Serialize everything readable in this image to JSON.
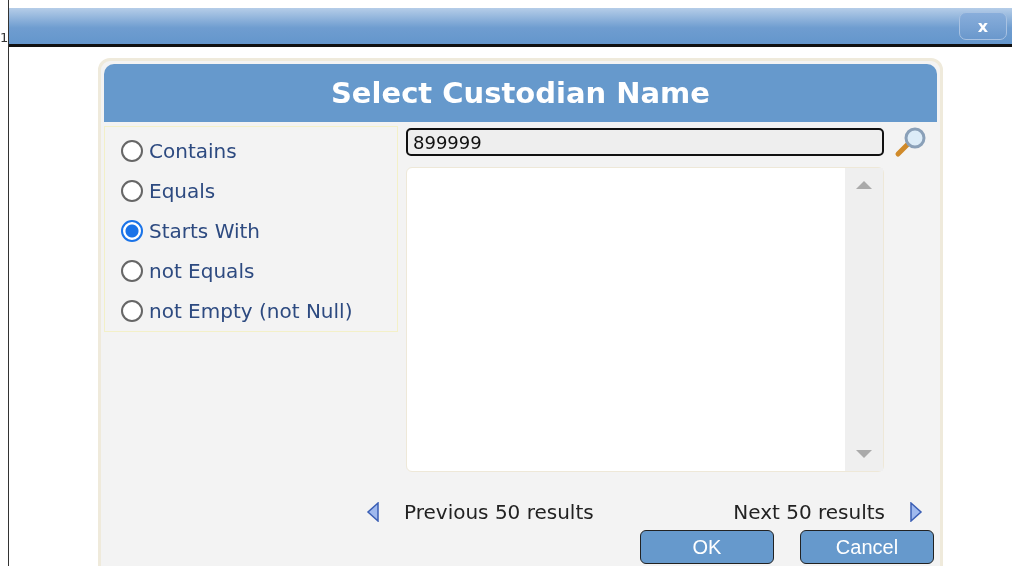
{
  "edge_text": "1",
  "window": {
    "close_label": "x"
  },
  "dialog": {
    "title": "Select Custodian Name",
    "match_options": [
      {
        "label": "Contains",
        "selected": false
      },
      {
        "label": "Equals",
        "selected": false
      },
      {
        "label": "Starts With",
        "selected": true
      },
      {
        "label": "not Equals",
        "selected": false
      },
      {
        "label": "not Empty (not Null)",
        "selected": false
      }
    ],
    "search": {
      "value": "899999"
    },
    "pagination": {
      "previous": "Previous 50 results",
      "next": "Next 50 results"
    },
    "buttons": [
      "OK",
      "Cancel"
    ]
  }
}
